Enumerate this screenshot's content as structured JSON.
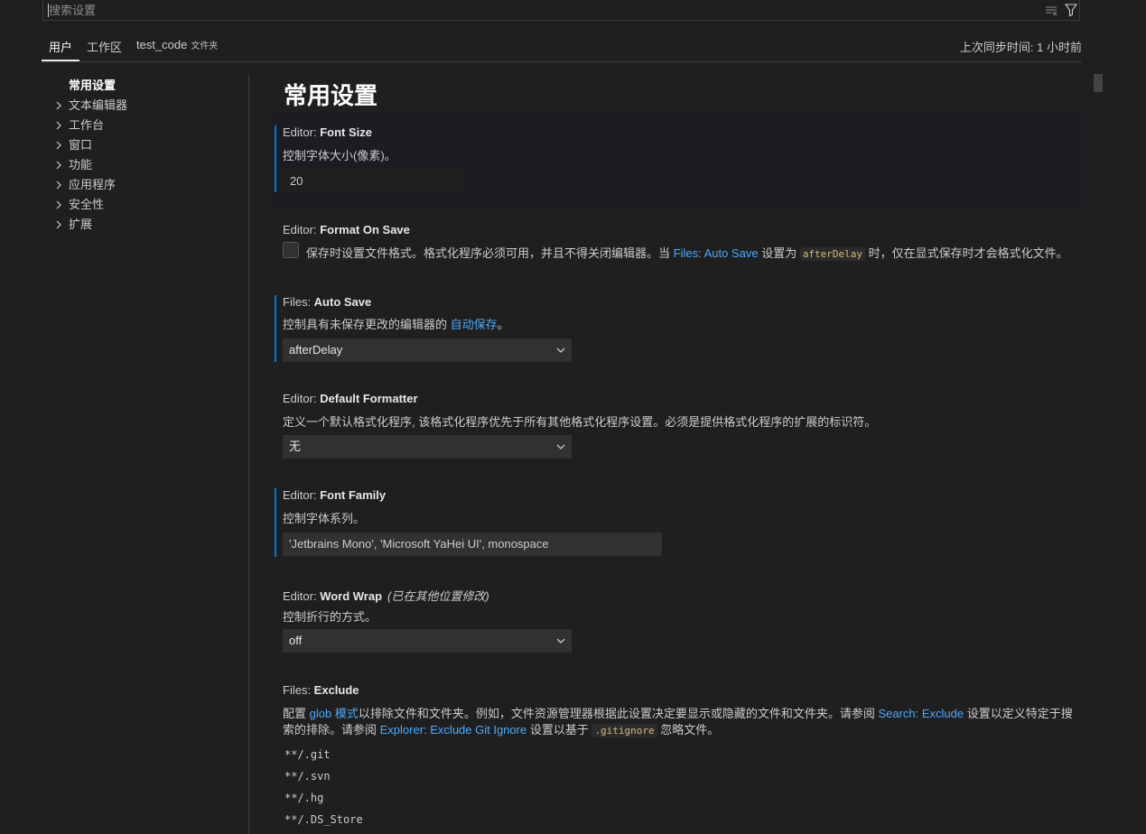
{
  "search": {
    "placeholder": "搜索设置"
  },
  "tabs": [
    {
      "label": "用户"
    },
    {
      "label": "工作区"
    },
    {
      "label": "test_code",
      "suffix": "文件夹"
    }
  ],
  "sync_status": "上次同步时间: 1 小时前",
  "toc": [
    {
      "label": "常用设置"
    },
    {
      "label": "文本编辑器"
    },
    {
      "label": "工作台"
    },
    {
      "label": "窗口"
    },
    {
      "label": "功能"
    },
    {
      "label": "应用程序"
    },
    {
      "label": "安全性"
    },
    {
      "label": "扩展"
    }
  ],
  "section_title": "常用设置",
  "settings": {
    "font_size": {
      "category": "Editor: ",
      "name": "Font Size",
      "desc": "控制字体大小(像素)。",
      "value": "20"
    },
    "format_on_save": {
      "category": "Editor: ",
      "name": "Format On Save",
      "desc_1": "保存时设置文件格式。格式化程序必须可用，并且不得关闭编辑器。当 ",
      "link": "Files: Auto Save",
      "desc_2": " 设置为 ",
      "code": "afterDelay",
      "desc_3": " 时，仅在显式保存时才会格式化文件。"
    },
    "auto_save": {
      "category": "Files: ",
      "name": "Auto Save",
      "desc_1": "控制具有未保存更改的编辑器的 ",
      "link": "自动保存",
      "desc_2": "。",
      "value": "afterDelay"
    },
    "default_formatter": {
      "category": "Editor: ",
      "name": "Default Formatter",
      "desc": "定义一个默认格式化程序, 该格式化程序优先于所有其他格式化程序设置。必须是提供格式化程序的扩展的标识符。",
      "value": "无"
    },
    "font_family": {
      "category": "Editor: ",
      "name": "Font Family",
      "desc": "控制字体系列。",
      "value": "'Jetbrains Mono', 'Microsoft YaHei UI', monospace"
    },
    "word_wrap": {
      "category": "Editor: ",
      "name": "Word Wrap",
      "modified": "(已在其他位置修改)",
      "desc": "控制折行的方式。",
      "value": "off"
    },
    "files_exclude": {
      "category": "Files: ",
      "name": "Exclude",
      "l1_a": "配置 ",
      "l1_link1": "glob 模式",
      "l1_b": "以排除文件和文件夹。例如，文件资源管理器根据此设置决定要显示或隐藏的文件和文件夹。请参阅 ",
      "l1_link2": "Search: Exclude",
      "l1_c": " 设置以定义特定于搜",
      "l2_a": "索的排除。请参阅 ",
      "l2_link": "Explorer: Exclude Git Ignore",
      "l2_b": " 设置以基于 ",
      "l2_code": ".gitignore",
      "l2_c": " 忽略文件。",
      "patterns": [
        "**/.git",
        "**/.svn",
        "**/.hg",
        "**/.DS_Store"
      ]
    }
  },
  "colors": {
    "accent": "#0078d4",
    "link": "#4daafc",
    "background": "#1f1f1f"
  }
}
